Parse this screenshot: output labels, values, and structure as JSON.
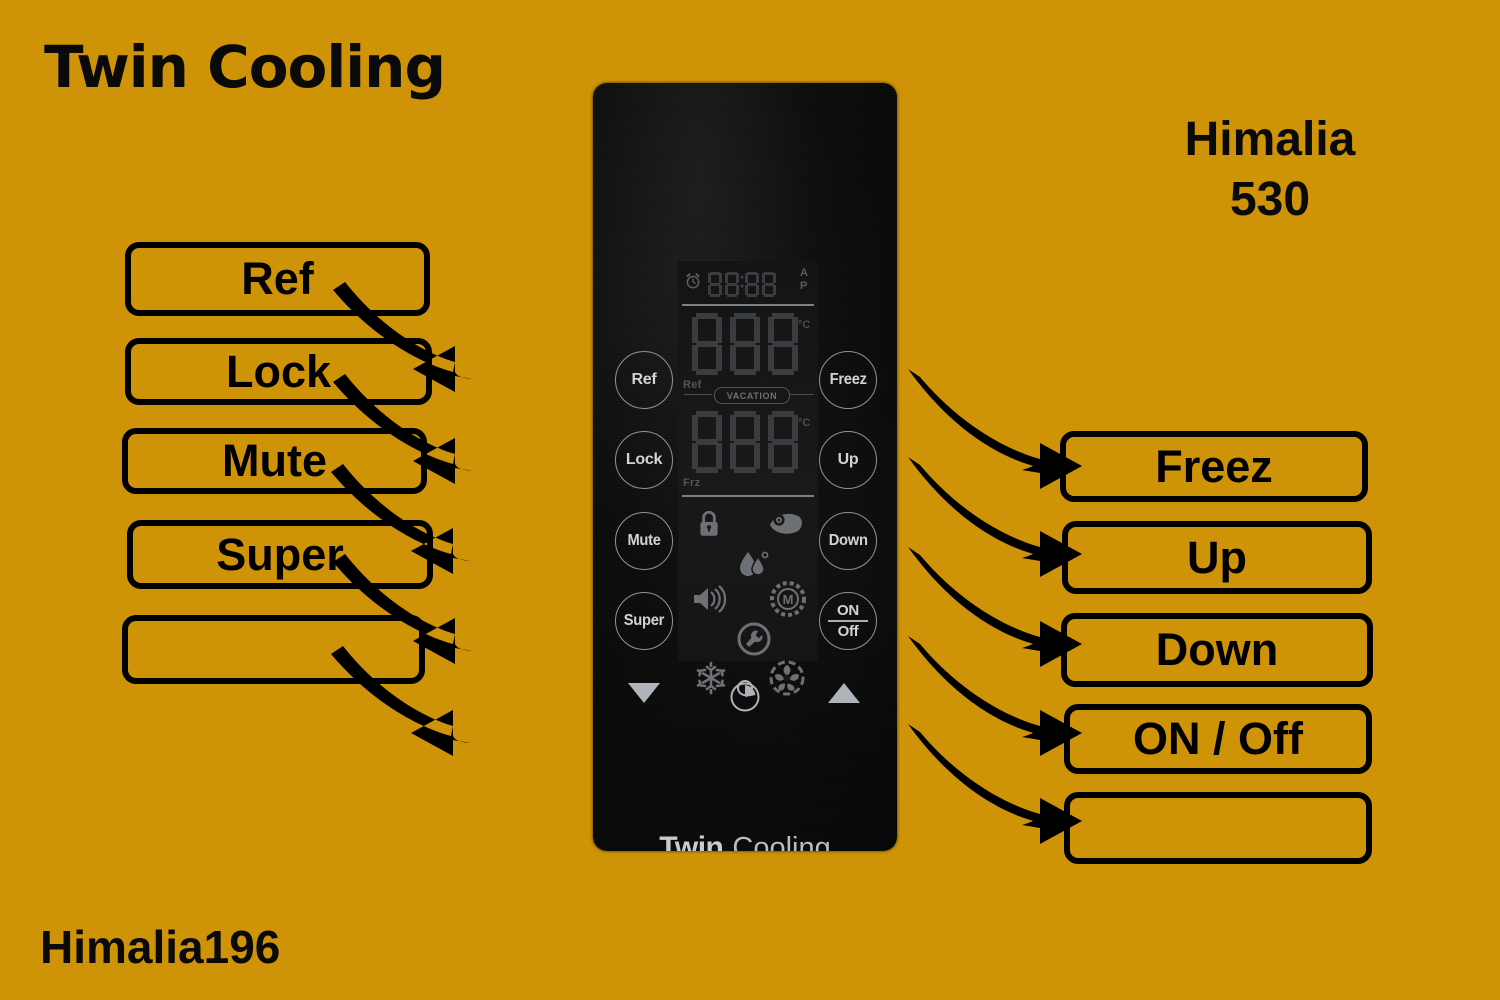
{
  "background_color": "#CE9306",
  "headings": {
    "top_left_title": "Twin Cooling",
    "top_right_title_line1": "Himalia",
    "top_right_title_line2": "530",
    "footer_tag": "Himalia196"
  },
  "left_callouts": [
    {
      "label": "Ref"
    },
    {
      "label": "Lock"
    },
    {
      "label": "Mute"
    },
    {
      "label": "Super"
    },
    {
      "label": ""
    }
  ],
  "right_callouts": [
    {
      "label": "Freez"
    },
    {
      "label": "Up"
    },
    {
      "label": "Down"
    },
    {
      "label": "ON / Off"
    },
    {
      "label": ""
    }
  ],
  "panel": {
    "left_keys": [
      "Ref",
      "Lock",
      "Mute",
      "Super"
    ],
    "right_keys": [
      "Freez",
      "Up",
      "Down"
    ],
    "onoff_key": {
      "top": "ON",
      "bottom": "Off"
    },
    "brand_bold": "Twin",
    "brand_light": "Cooling",
    "bottom_indicators": [
      "down-triangle",
      "timer-clock",
      "up-triangle"
    ]
  },
  "lcd": {
    "clock_icon": "alarm-clock-icon",
    "clock_value": "88:88",
    "am_label": "A",
    "pm_label": "P",
    "ref_value": "88",
    "ref_unit": "°C",
    "ref_label": "Ref",
    "vacation_label": "VACATION",
    "frz_value": "88",
    "frz_unit": "°C",
    "frz_label": "Frz",
    "status_icons": [
      "lock-icon",
      "eco-eye-icon",
      "humidity-drop-icon",
      "speaker-mute-icon",
      "m-circle-icon",
      "wrench-service-icon",
      "snowflake-icon",
      "fan-icon"
    ]
  }
}
